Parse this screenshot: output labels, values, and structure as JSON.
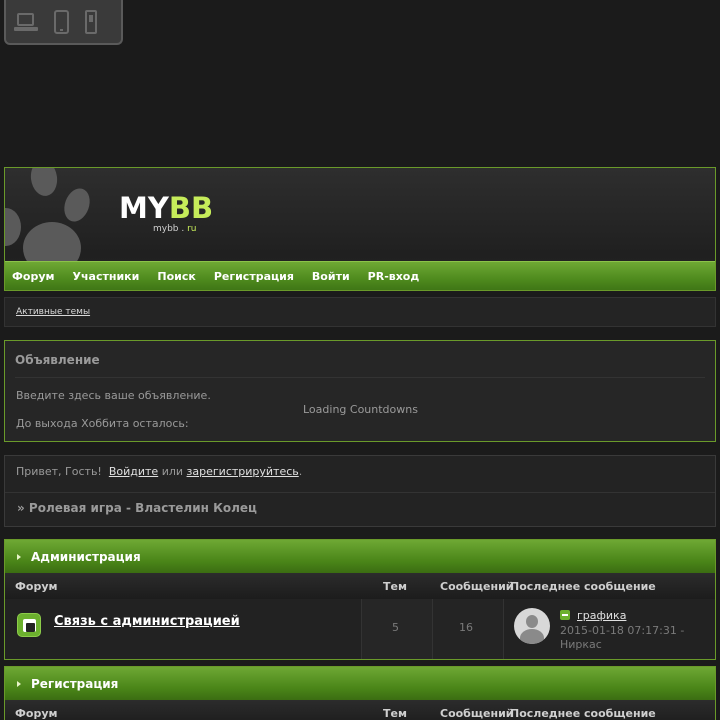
{
  "device_switcher": {
    "icons": [
      "laptop-icon",
      "tablet-icon",
      "phone-icon"
    ]
  },
  "header": {
    "logo_main_my": "MY",
    "logo_main_bb": "BB",
    "logo_sub_site": "mybb . ",
    "logo_sub_tld": "ru"
  },
  "nav": {
    "items": [
      "Форум",
      "Участники",
      "Поиск",
      "Регистрация",
      "Войти",
      "PR-вход"
    ]
  },
  "active_topics": {
    "link": "Активные темы"
  },
  "announcement": {
    "title": "Объявление",
    "text": "Введите здесь ваше объявление.",
    "countdown_label": "До выхода Хоббита осталось:",
    "loading": "Loading Countdowns"
  },
  "welcome": {
    "greeting": "Привет, Гость!",
    "login_link": "Войдите",
    "or": "или",
    "register_link": "зарегистрируйтесь",
    "period": ".",
    "crumb": "» Ролевая игра - Властелин Колец"
  },
  "columns": {
    "forum": "Форум",
    "topics": "Тем",
    "posts": "Сообщений",
    "last": "Последнее сообщение"
  },
  "categories": [
    {
      "title": "Администрация",
      "forums": [
        {
          "name": "Связь с администрацией",
          "topics": "5",
          "posts": "16",
          "last_topic": "графика",
          "last_date": "2015-01-18 07:17:31 -",
          "last_author": "Ниркас"
        }
      ]
    },
    {
      "title": "Регистрация",
      "forums": []
    }
  ],
  "colors": {
    "accent_green": "#6ea834",
    "logo_green": "#c6ec5a",
    "background": "#1b1b1b"
  }
}
